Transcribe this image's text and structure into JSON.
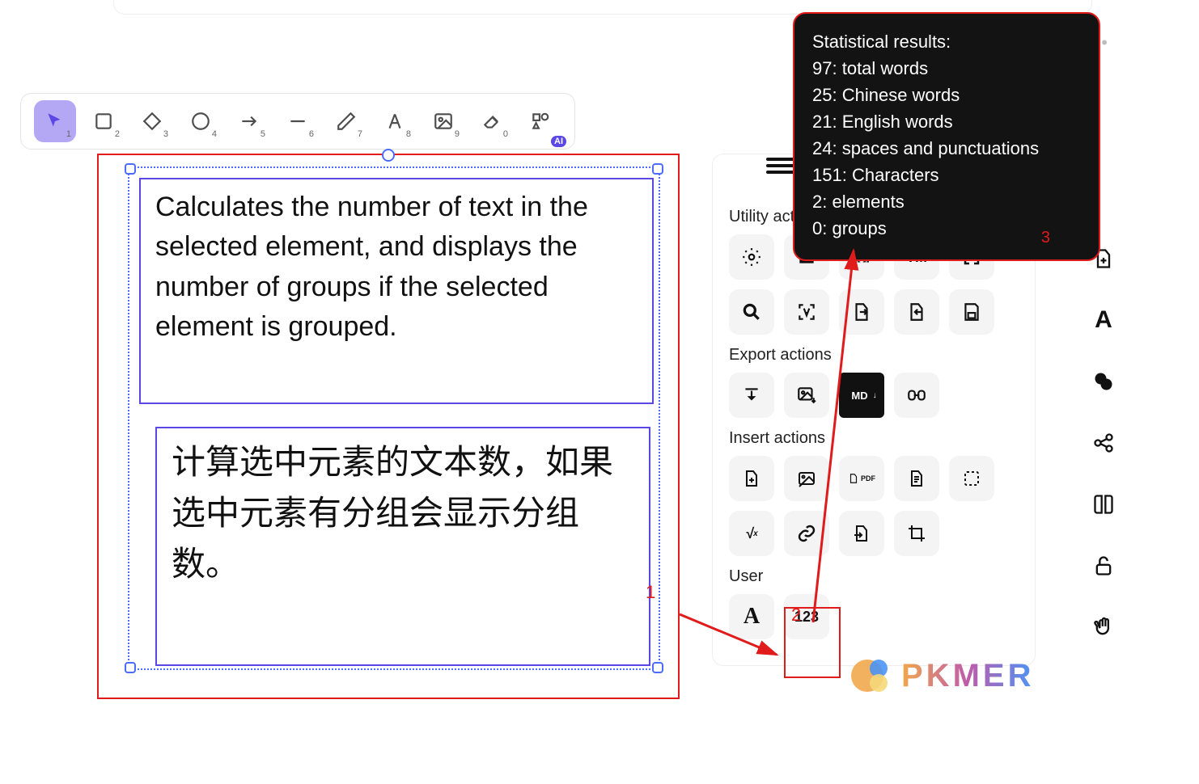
{
  "toolbar": {
    "items": [
      {
        "name": "select",
        "sub": "1"
      },
      {
        "name": "rect",
        "sub": "2"
      },
      {
        "name": "diamond",
        "sub": "3"
      },
      {
        "name": "circle",
        "sub": "4"
      },
      {
        "name": "arrow",
        "sub": "5"
      },
      {
        "name": "line",
        "sub": "6"
      },
      {
        "name": "pencil",
        "sub": "7"
      },
      {
        "name": "text",
        "sub": "8"
      },
      {
        "name": "image",
        "sub": "9"
      },
      {
        "name": "eraser",
        "sub": "0"
      },
      {
        "name": "shapes",
        "badge": "AI"
      }
    ]
  },
  "canvas": {
    "eng_text": "Calculates the number of text in the selected element, and displays the number of groups if the selected element is grouped.",
    "chn_text": "计算选中元素的文本数，如果选中元素有分组会显示分组数。"
  },
  "annotations": {
    "a1": "1",
    "a2": "2",
    "a3": "3"
  },
  "panel": {
    "section1": "Utility actions",
    "section2": "Export actions",
    "section3": "Insert actions",
    "section4": "User",
    "utility": [
      "settings",
      "read",
      "brackets",
      "tm",
      "fullscreen",
      "search",
      "ocr",
      "export-right",
      "import-left",
      "save"
    ],
    "export": [
      "download",
      "image",
      "md",
      "link"
    ],
    "insert": [
      "file",
      "image",
      "pdf",
      "page",
      "select",
      "math",
      "link",
      "file-in",
      "crop"
    ],
    "user": [
      "font",
      "count"
    ],
    "labels": {
      "tm": "TM",
      "md": "MD",
      "pdf": "PDF",
      "count": "123",
      "brackets": "[[ ]]"
    }
  },
  "dock": [
    "add-file",
    "text",
    "rings",
    "graph",
    "book",
    "unlock",
    "hand"
  ],
  "tooltip": {
    "title": "Statistical results:",
    "rows": [
      {
        "n": "97",
        "t": "total words"
      },
      {
        "n": "25",
        "t": "Chinese words"
      },
      {
        "n": "21",
        "t": "English words"
      },
      {
        "n": "24",
        "t": "spaces and punctuations"
      },
      {
        "n": "151",
        "t": "Characters"
      },
      {
        "n": "2",
        "t": "elements"
      },
      {
        "n": "0",
        "t": "groups"
      }
    ]
  },
  "brand": "PKMER"
}
